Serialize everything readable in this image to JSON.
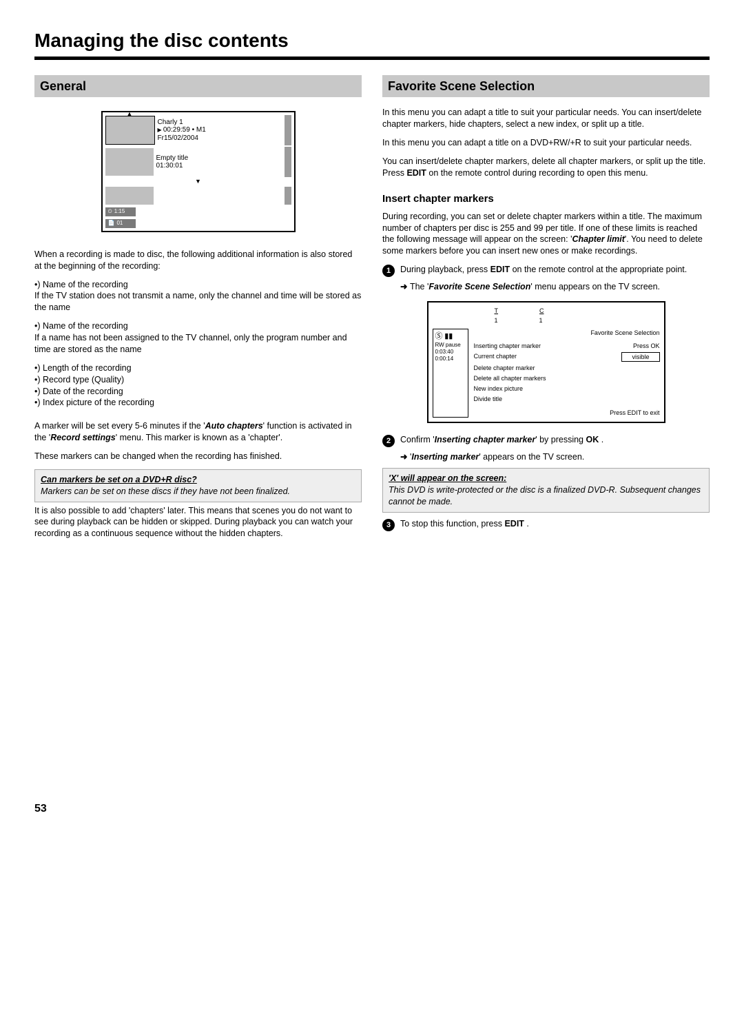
{
  "pageTitle": "Managing the disc contents",
  "pageNumber": "53",
  "left": {
    "header": "General",
    "fig1": {
      "title1": "Charly 1",
      "line1": "00:29:59 • M1",
      "date1": "Fr15/02/2004",
      "title2": "Empty title",
      "time2": "01:30:01",
      "tag1_icon": "⏲",
      "tag1": "1:15",
      "tag2_icon": "📄",
      "tag2": "01"
    },
    "intro": "When a recording is made to disc, the following additional information is also stored at the beginning of the recording:",
    "bullets1": [
      "Name of the recording"
    ],
    "note1": "If the TV station does not transmit a name, only the channel and time will be stored as the name",
    "bullets2": [
      "Name of the recording"
    ],
    "note2": "If a name has not been assigned to the TV channel, only the program number and time are stored as the name",
    "bullets3": [
      "Length of the recording",
      "Record type (Quality)",
      "Date of the recording",
      "Index picture of the recording"
    ],
    "para2a": "A marker will be set every 5-6 minutes if the '",
    "para2b": "Auto chapters",
    "para2c": "' function is activated in the '",
    "para2d": "Record settings",
    "para2e": "' menu. This marker is known as a 'chapter'.",
    "para3": "These markers can be changed when the recording has finished.",
    "notebox": {
      "title": "Can markers be set on a DVD+R disc?",
      "body": "Markers can be set on these discs if they have not been finalized."
    },
    "para4": "It is also possible to add 'chapters' later. This means that scenes you do not want to see during playback can be hidden or skipped. During playback you can watch your recording as a continuous sequence without the hidden chapters."
  },
  "right": {
    "header": "Favorite Scene Selection",
    "para1": "In this menu you can adapt a title to suit your particular needs. You can insert/delete chapter markers, hide chapters, select a new index, or split up a title.",
    "para2": "In this menu you can adapt a title on a DVD+RW/+R to suit your particular needs.",
    "para3a": "You can insert/delete chapter markers, delete all chapter markers, or split up the title. Press ",
    "para3b": "EDIT",
    "para3c": " on the remote control during recording to open this menu.",
    "sub1": "Insert chapter markers",
    "sub1_para_a": "During recording, you can set or delete chapter markers within a title. The maximum number of chapters per disc is 255 and 99 per title. If one of these limits is reached the following message will appear on the screen: '",
    "sub1_para_b": "Chapter limit",
    "sub1_para_c": "'. You need to delete some markers before you can insert new ones or make recordings.",
    "step1_num": "1",
    "step1a": "During playback, press ",
    "step1b": "EDIT",
    "step1c": " on the remote control at the appropriate point.",
    "step1_res_a": "The '",
    "step1_res_b": "Favorite Scene Selection",
    "step1_res_c": "' menu appears on the TV screen.",
    "fig2": {
      "colT": "T",
      "colC": "C",
      "valT": "1",
      "valC": "1",
      "side_top": "Ⓢ ▮▮",
      "side_l2": "RW  pause",
      "side_l3": "0:03:40",
      "side_l4": "0:00:14",
      "menuTitle": "Favorite Scene Selection",
      "items": [
        {
          "label": "Inserting chapter marker",
          "right": "Press OK"
        },
        {
          "label": "Current chapter",
          "right": "visible",
          "boxed": true
        },
        {
          "label": "Delete chapter marker"
        },
        {
          "label": "Delete all chapter markers"
        },
        {
          "label": "New index picture"
        },
        {
          "label": "Divide title"
        }
      ],
      "exit": "Press EDIT to exit"
    },
    "step2_num": "2",
    "step2a": "Confirm '",
    "step2b": "Inserting chapter marker",
    "step2c": "' by pressing ",
    "step2d": "OK",
    "step2e": " .",
    "step2_res_a": "'",
    "step2_res_b": "Inserting marker",
    "step2_res_c": "' appears on the TV screen.",
    "notebox2": {
      "title": "'X' will appear on the screen:",
      "body": "This DVD is write-protected or the disc is a finalized DVD-R. Subsequent changes cannot be made."
    },
    "step3_num": "3",
    "step3a": "To stop this function, press ",
    "step3b": "EDIT",
    "step3c": " ."
  }
}
